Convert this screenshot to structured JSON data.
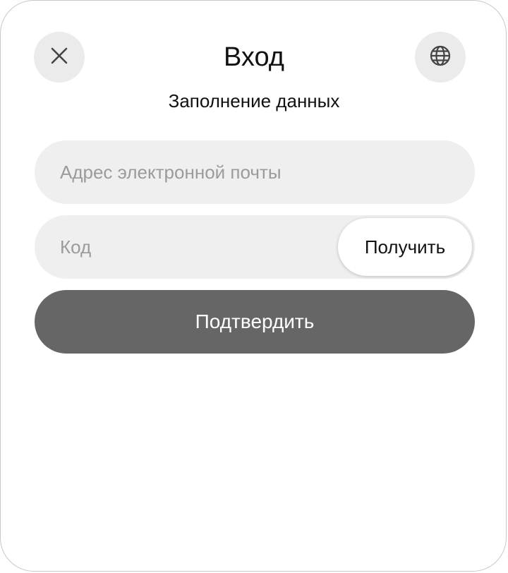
{
  "dialog": {
    "title": "Вход",
    "subtitle": "Заполнение данных",
    "close_icon": "close-icon",
    "language_icon": "globe-icon"
  },
  "form": {
    "email": {
      "value": "",
      "placeholder": "Адрес электронной почты"
    },
    "code": {
      "value": "",
      "placeholder": "Код",
      "get_code_label": "Получить"
    },
    "confirm_label": "Подтвердить"
  },
  "colors": {
    "field_bg": "#efefef",
    "icon_button_bg": "#ebebeb",
    "confirm_bg": "#666666",
    "placeholder": "#9b9b9b"
  }
}
